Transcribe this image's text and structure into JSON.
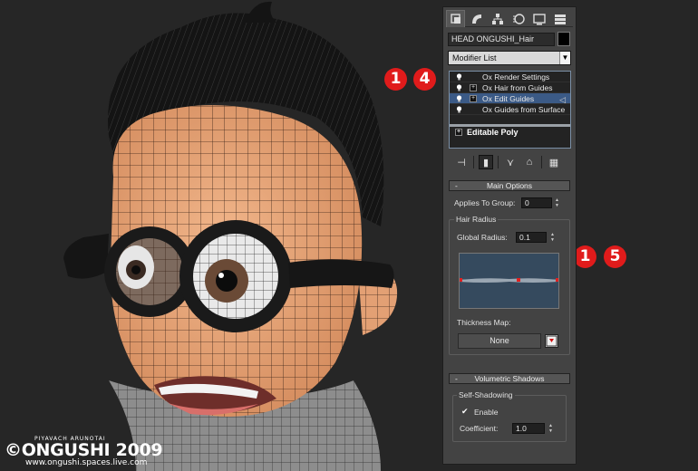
{
  "watermark": {
    "author": "PIYAVACH ARUNOTAI",
    "logo": "©ONGUSHI 2009",
    "url": "www.ongushi.spaces.live.com"
  },
  "badges": {
    "step_a": "14",
    "step_b": "15"
  },
  "panel": {
    "tabs": [
      {
        "icon": "create-icon",
        "active": true
      },
      {
        "icon": "modify-icon",
        "active": false
      },
      {
        "icon": "hierarchy-icon",
        "active": false
      },
      {
        "icon": "motion-icon",
        "active": false
      },
      {
        "icon": "display-icon",
        "active": false
      },
      {
        "icon": "utilities-icon",
        "active": false
      }
    ],
    "object_name": "HEAD ONGUSHI_Hair",
    "object_color": "#000000",
    "modifier_list": "Modifier List",
    "stack": [
      {
        "label": "Ox Render Settings",
        "expandable": false,
        "selected": false
      },
      {
        "label": "Ox Hair from Guides",
        "expandable": true,
        "selected": false
      },
      {
        "label": "Ox Edit Guides",
        "expandable": true,
        "selected": true
      },
      {
        "label": "Ox Guides from Surface",
        "expandable": false,
        "selected": false
      }
    ],
    "stack_base": "Editable Poly",
    "main_options": {
      "title": "Main Options",
      "applies_to_group_label": "Applies To Group:",
      "applies_to_group_value": "0",
      "hair_radius_title": "Hair Radius",
      "global_radius_label": "Global Radius:",
      "global_radius_value": "0.1",
      "thickness_map_label": "Thickness Map:",
      "thickness_map_button": "None"
    },
    "volumetric_shadows": {
      "title": "Volumetric Shadows",
      "self_shadowing_title": "Self-Shadowing",
      "enable_label": "Enable",
      "enable_checked": true,
      "coefficient_label": "Coefficient:",
      "coefficient_value": "1.0"
    }
  },
  "colors": {
    "badge": "#e01b1b",
    "panel": "#434343",
    "stack_selected": "#3b5a86",
    "curve_bg": "#354a5e",
    "skin": "#e9a67a"
  }
}
